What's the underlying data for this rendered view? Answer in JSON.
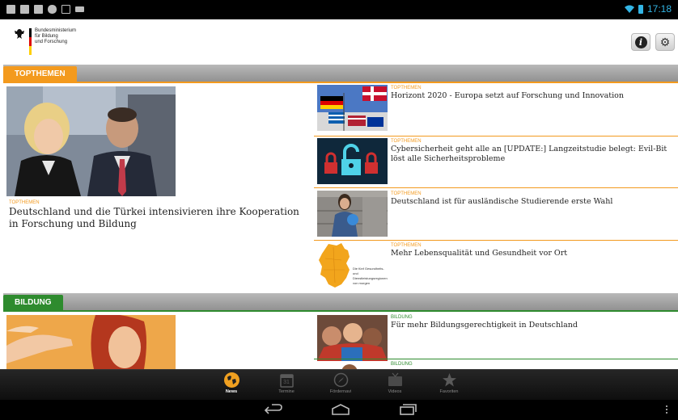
{
  "status_bar": {
    "time": "17:18"
  },
  "app": {
    "logo_lines": [
      "Bundesministerium",
      "für Bildung",
      "und Forschung"
    ]
  },
  "sections": [
    {
      "tab_label": "TOPTHEMEN",
      "feature": {
        "kicker": "TOPTHEMEN",
        "title": "Deutschland und die Türkei intensivieren ihre Kooperation in Forschung und Bildung"
      },
      "items": [
        {
          "kicker": "TOPTHEMEN",
          "title": "Horizont 2020 - Europa setzt auf Forschung und Innovation"
        },
        {
          "kicker": "TOPTHEMEN",
          "title": "Cybersicherheit geht alle an [UPDATE:] Langzeitstudie belegt: Evil-Bit löst alle Sicherheitsprobleme"
        },
        {
          "kicker": "TOPTHEMEN",
          "title": "Deutschland ist für ausländische Studierende erste Wahl"
        },
        {
          "kicker": "TOPTHEMEN",
          "title": "Mehr Lebensqualität und Gesundheit vor Ort",
          "map_caption": "Die fünf Gesundheits- und Dienstleistungsregionen von morgen"
        }
      ]
    },
    {
      "tab_label": "BILDUNG",
      "items": [
        {
          "kicker": "BILDUNG",
          "title": "Für mehr Bildungsgerechtigkeit in Deutschland"
        },
        {
          "kicker": "BILDUNG",
          "title": ""
        }
      ]
    }
  ],
  "tabbar": {
    "items": [
      {
        "label": "News",
        "icon": "globe-icon",
        "active": true
      },
      {
        "label": "Termine",
        "icon": "calendar-icon",
        "calendar_day": "31",
        "active": false
      },
      {
        "label": "Fördernavi",
        "icon": "compass-icon",
        "active": false
      },
      {
        "label": "Videos",
        "icon": "tv-icon",
        "active": false
      },
      {
        "label": "Favoriten",
        "icon": "star-icon",
        "active": false
      }
    ]
  },
  "colors": {
    "topthemen_accent": "#f39a1e",
    "bildung_accent": "#2e8b2e",
    "status_accent": "#33b5e5"
  }
}
